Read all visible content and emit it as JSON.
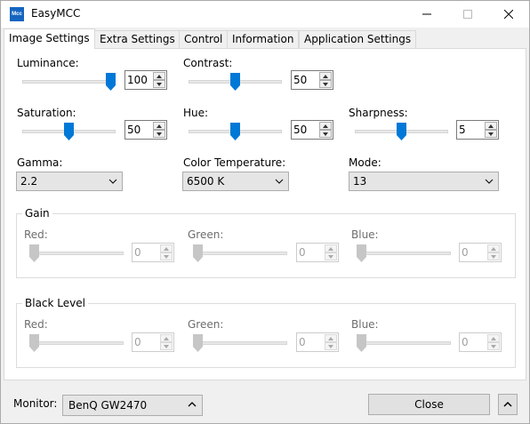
{
  "window": {
    "title": "EasyMCC",
    "app_icon_text": "Mcc"
  },
  "tabs": [
    {
      "label": "Image Settings",
      "active": true
    },
    {
      "label": "Extra Settings"
    },
    {
      "label": "Control"
    },
    {
      "label": "Information"
    },
    {
      "label": "Application Settings"
    }
  ],
  "image_settings": {
    "luminance": {
      "label": "Luminance:",
      "value": "100",
      "level": 1.0
    },
    "contrast": {
      "label": "Contrast:",
      "value": "50",
      "level": 0.5
    },
    "saturation": {
      "label": "Saturation:",
      "value": "50",
      "level": 0.5
    },
    "hue": {
      "label": "Hue:",
      "value": "50",
      "level": 0.5
    },
    "sharpness": {
      "label": "Sharpness:",
      "value": "5",
      "level": 0.5
    },
    "gamma": {
      "label": "Gamma:",
      "value": "2.2"
    },
    "color_temperature": {
      "label": "Color Temperature:",
      "value": "6500 K"
    },
    "mode": {
      "label": "Mode:",
      "value": "13"
    }
  },
  "gain": {
    "title": "Gain",
    "red": {
      "label": "Red:",
      "value": "0",
      "level": 0
    },
    "green": {
      "label": "Green:",
      "value": "0",
      "level": 0
    },
    "blue": {
      "label": "Blue:",
      "value": "0",
      "level": 0
    }
  },
  "black_level": {
    "title": "Black Level",
    "red": {
      "label": "Red:",
      "value": "0",
      "level": 0
    },
    "green": {
      "label": "Green:",
      "value": "0",
      "level": 0
    },
    "blue": {
      "label": "Blue:",
      "value": "0",
      "level": 0
    }
  },
  "footer": {
    "monitor_label": "Monitor:",
    "monitor_value": "BenQ GW2470",
    "close_label": "Close"
  },
  "colors": {
    "accent": "#0078d7",
    "disabled": "#c6c6c6"
  }
}
